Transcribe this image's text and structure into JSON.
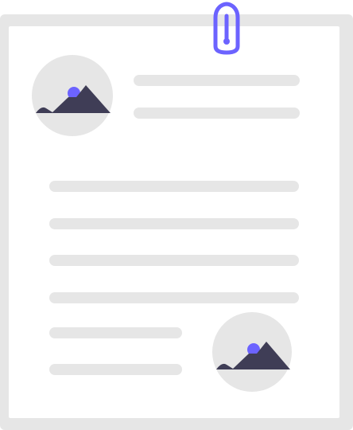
{
  "illustration": {
    "paper_frame_color": "#e6e6e6",
    "paper_color": "#ffffff",
    "text_line_color": "#e6e6e6",
    "photo_circle_color": "#e6e6e6",
    "mountain_color": "#3f3d56",
    "sun_color": "#6c63ff",
    "paperclip_color": "#6c63ff",
    "icons": {
      "paperclip": "paperclip-icon",
      "image_placeholder": "image-placeholder-icon"
    }
  }
}
